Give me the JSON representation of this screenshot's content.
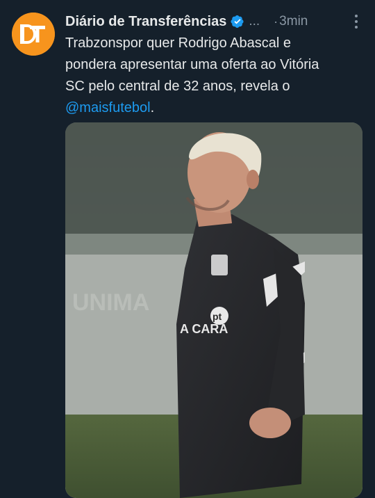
{
  "account": {
    "avatar_icon": "dt-logo-icon",
    "avatar_color": "#f7941d",
    "name": "Diário de Transferências",
    "verified_icon": "verified-badge-icon",
    "verified_color": "#1d9bf0",
    "handle": "...",
    "separator": "·",
    "time": "3min"
  },
  "menu": {
    "icon": "more-vertical-icon"
  },
  "tweet": {
    "text_lines": [
      "Trabzonspor quer Rodrigo Abascal e",
      "pondera apresentar uma oferta ao Vitória",
      "SC pelo central de 32 anos, revela o"
    ],
    "mention": "@maisfutebol",
    "after_mention": "."
  },
  "media": {
    "description_icon": "photo-player-training",
    "shirt_text": "A CARA",
    "shirt_badge": "pt"
  },
  "theme": {
    "background": "#15202b",
    "text": "#e7e9ea",
    "muted": "#8b98a5",
    "link": "#1d9bf0"
  }
}
